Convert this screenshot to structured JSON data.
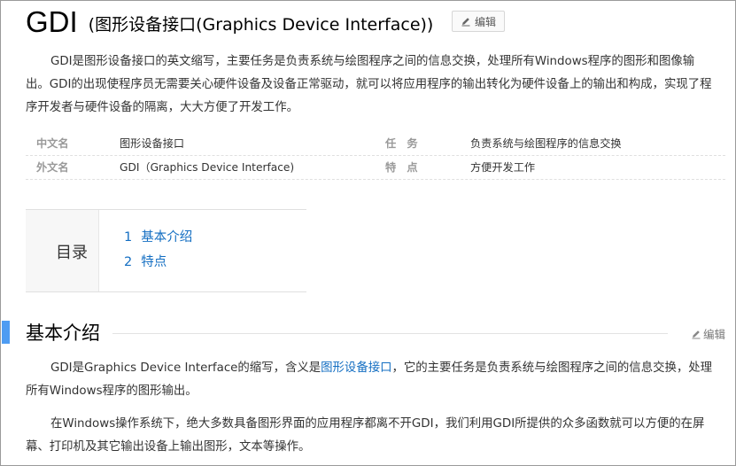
{
  "header": {
    "title": "GDI",
    "subtitle": "(图形设备接口(Graphics Device Interface))",
    "edit_label": "编辑"
  },
  "intro": "GDI是图形设备接口的英文缩写，主要任务是负责系统与绘图程序之间的信息交换，处理所有Windows程序的图形和图像输出。GDI的出现使程序员无需要关心硬件设备及设备正常驱动，就可以将应用程序的输出转化为硬件设备上的输出和构成，实现了程序开发者与硬件设备的隔离，大大方便了开发工作。",
  "info": {
    "rows": [
      {
        "k1": "中文名",
        "v1": "图形设备接口",
        "k2": "任　务",
        "v2": "负责系统与绘图程序的信息交换"
      },
      {
        "k1": "外文名",
        "v1": "GDI（Graphics Device Interface)",
        "k2": "特　点",
        "v2": "方便开发工作"
      }
    ]
  },
  "toc": {
    "title": "目录",
    "items": [
      {
        "num": "1",
        "label": "基本介绍"
      },
      {
        "num": "2",
        "label": "特点"
      }
    ]
  },
  "section": {
    "title": "基本介绍",
    "edit_label": "编辑",
    "para1_before": "GDI是Graphics Device Interface的缩写，含义是",
    "para1_link": "图形设备接口",
    "para1_after": "，它的主要任务是负责系统与绘图程序之间的信息交换，处理所有Windows程序的图形输出。",
    "para2": "在Windows操作系统下，绝大多数具备图形界面的应用程序都离不开GDI，我们利用GDI所提供的众多函数就可以方便的在屏幕、打印机及其它输出设备上输出图形，文本等操作。"
  },
  "colors": {
    "accent": "#4e9cf2",
    "link": "#136ec2"
  },
  "icons": {
    "edit": "pencil-icon"
  }
}
